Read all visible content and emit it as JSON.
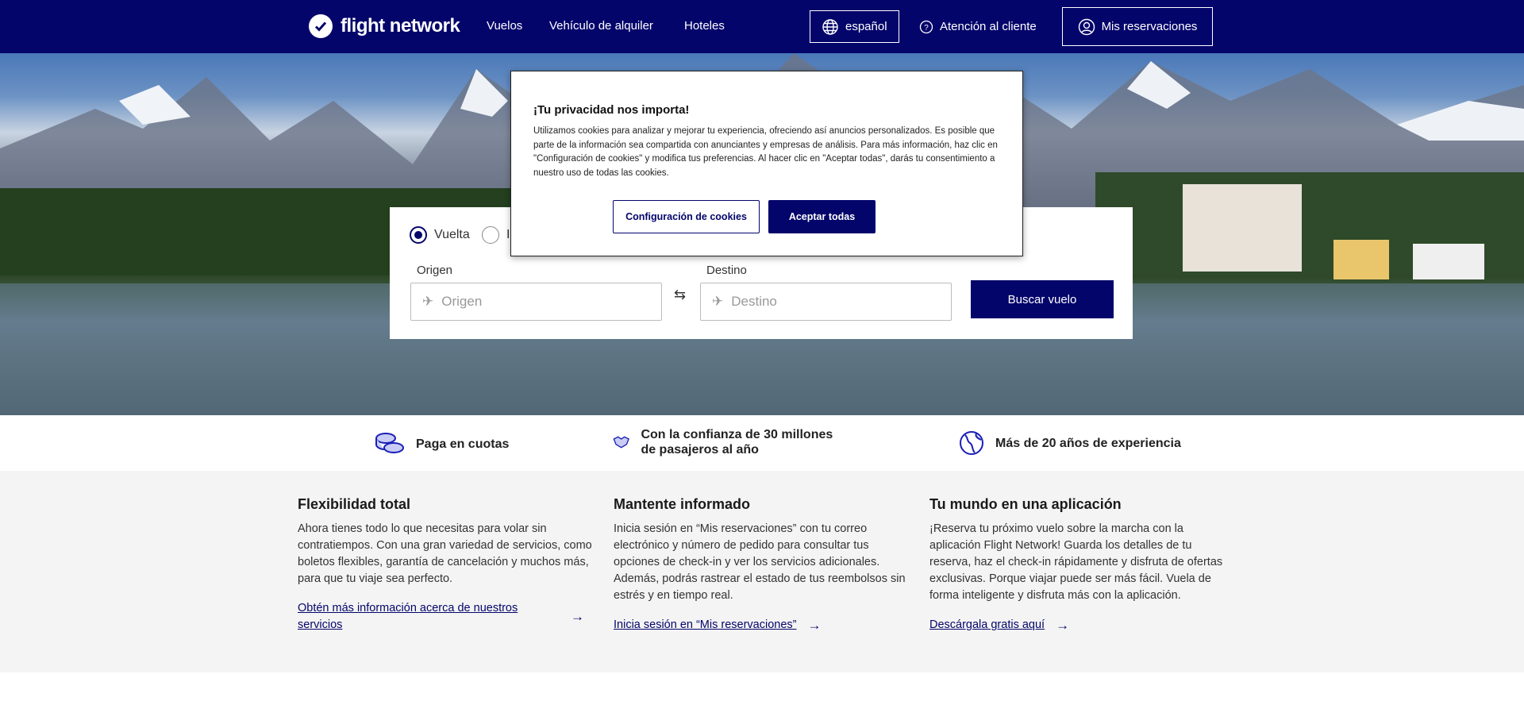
{
  "header": {
    "logo_text": "flight network",
    "nav": [
      "Vuelos",
      "Vehículo de alquiler",
      "Hoteles"
    ],
    "language": "español",
    "support": "Atención al cliente",
    "bookings": "Mis reservaciones",
    "bg_color": "#04056b"
  },
  "search": {
    "trip_types": [
      "Vuelta",
      "I"
    ],
    "selected_trip_type": "Vuelta",
    "origin_label": "Origen",
    "origin_placeholder": "Origen",
    "destination_label": "Destino",
    "destination_placeholder": "Destino",
    "search_button": "Buscar vuelo"
  },
  "cookie_modal": {
    "title": "¡Tu privacidad nos importa!",
    "body": "Utilizamos cookies para analizar y mejorar tu experiencia, ofreciendo así anuncios personalizados. Es posible que parte de la información sea compartida con anunciantes y empresas de análisis. Para más información, haz clic en \"Configuración de cookies\" y modifica tus preferencias. Al hacer clic en \"Aceptar todas\", darás tu consentimiento a nuestro uso de todas las cookies.",
    "settings_button": "Configuración de cookies",
    "accept_button": "Aceptar todas"
  },
  "features": [
    {
      "icon": "coins-icon",
      "text": "Paga en cuotas"
    },
    {
      "icon": "handshake-icon",
      "text": "Con la confianza de 30 millones de pasajeros al año"
    },
    {
      "icon": "globe-icon",
      "text": "Más de 20 años de experiencia"
    }
  ],
  "info_columns": [
    {
      "title": "Flexibilidad total",
      "body": "Ahora tienes todo lo que necesitas para volar sin contratiempos. Con una gran variedad de servicios, como boletos flexibles, garantía de cancelación y muchos más, para que tu viaje sea perfecto.",
      "link": "Obtén más información acerca de nuestros servicios"
    },
    {
      "title": "Mantente informado",
      "body": "Inicia sesión en “Mis reservaciones” con tu correo electrónico y número de pedido para consultar tus opciones de check-in y ver los servicios adicionales. Además, podrás rastrear el estado de tus reembolsos sin estrés y en tiempo real.",
      "link": "Inicia sesión en “Mis reservaciones”"
    },
    {
      "title": "Tu mundo en una aplicación",
      "body": "¡Reserva tu próximo vuelo sobre la marcha con la aplicación Flight Network! Guarda los detalles de tu reserva, haz el check-in rápidamente y disfruta de ofertas exclusivas. Porque viajar puede ser más fácil. Vuela de forma inteligente y disfruta más con la aplicación.",
      "link": "Descárgala gratis aquí"
    }
  ]
}
